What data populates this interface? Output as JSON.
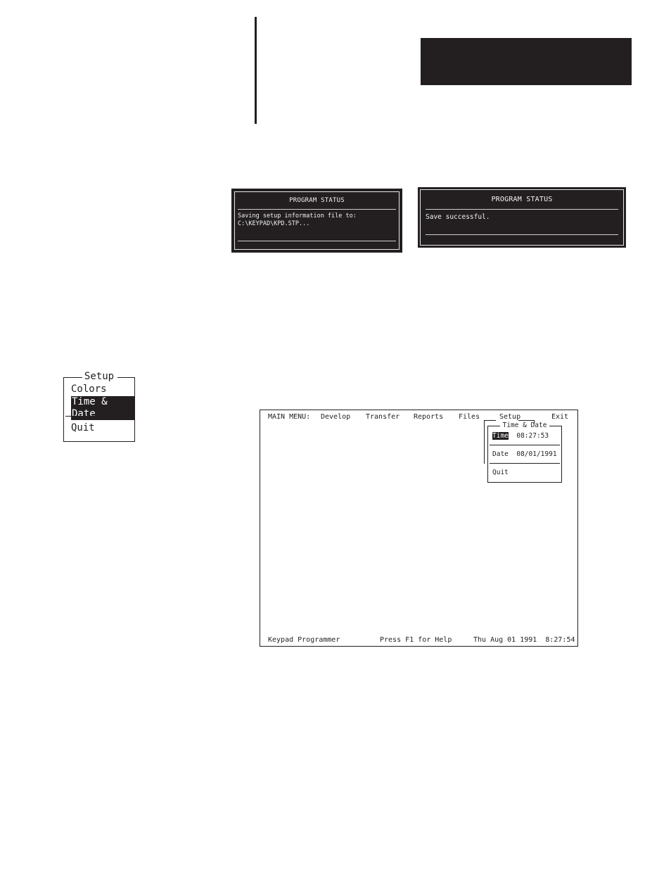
{
  "page": {
    "header_bar_color": "#231f20"
  },
  "status_dialogs": [
    {
      "title": "PROGRAM STATUS",
      "message": "Saving setup information file to:\nC:\\KEYPAD\\KPD.STP..."
    },
    {
      "title": "PROGRAM STATUS",
      "message": "Save successful."
    }
  ],
  "setup_menu": {
    "title": "Setup",
    "items": [
      {
        "label": "Colors",
        "selected": false
      },
      {
        "label": "Time & Date",
        "selected": true
      },
      {
        "label": "Quit",
        "selected": false
      }
    ]
  },
  "main_screen": {
    "menu_label": "MAIN MENU:",
    "menu_items": [
      "Develop",
      "Transfer",
      "Reports",
      "Files",
      "Setup",
      "Exit"
    ],
    "time_date_popup": {
      "title": "Time & Date",
      "time_label": "Time",
      "time_value": "08:27:53",
      "date_label": "Date",
      "date_value": "08/01/1991",
      "quit_label": "Quit"
    },
    "status_bar": {
      "app_name": "Keypad Programmer",
      "help_hint": "Press F1 for Help",
      "datetime": "Thu Aug 01 1991  8:27:54"
    }
  }
}
